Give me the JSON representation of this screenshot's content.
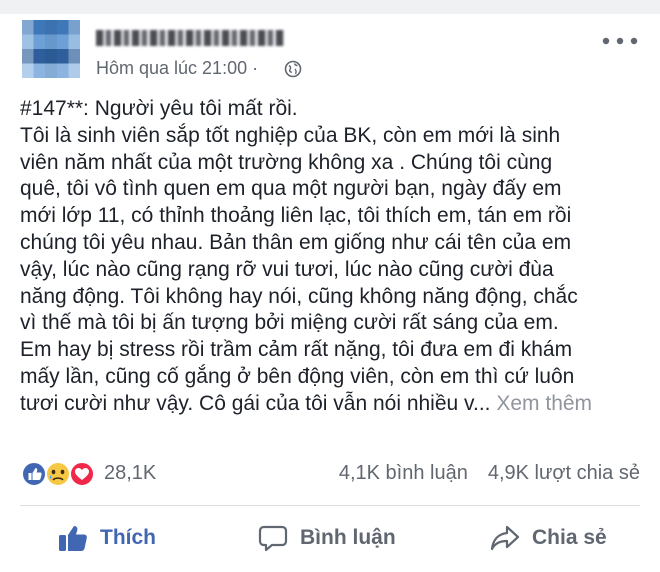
{
  "post": {
    "time": "Hôm qua lúc 21:00 ·",
    "lines": [
      "#147**: Người yêu tôi mất rồi.",
      "Tôi là sinh viên sắp tốt nghiệp của BK, còn em mới là sinh",
      "viên năm nhất của một trường không xa . Chúng tôi cùng",
      "quê, tôi vô tình quen em qua một người bạn, ngày đấy em",
      "mới lớp 11, có thỉnh thoảng liên lạc, tôi thích em, tán em rồi",
      "chúng tôi yêu nhau. Bản thân em giống như cái tên của em",
      "vậy, lúc nào cũng rạng rỡ vui tươi, lúc nào cũng cười đùa",
      "năng động. Tôi không hay nói, cũng không năng động, chắc",
      "vì thế mà tôi bị ấn tượng bởi miệng cười rất sáng của em.",
      "Em hay bị stress rồi trầm cảm rất nặng, tôi đưa em đi khám",
      "mấy lần, cũng cố gắng ở bên động viên, còn em thì cứ luôn"
    ],
    "last_line": "tươi cười như vậy. Cô gái của tôi vẫn nói nhiều v...",
    "see_more": "Xem thêm"
  },
  "stats": {
    "reactions_count": "28,1K",
    "comments": "4,1K bình luận",
    "shares": "4,9K lượt chia sẻ"
  },
  "actions": {
    "like": "Thích",
    "comment": "Bình luận",
    "share": "Chia sẻ"
  },
  "colors": {
    "like_blue": "#4267b2",
    "text": "#1d2129",
    "muted": "#616770",
    "love_red": "#f0284a",
    "sad_yellow": "#f7c844"
  },
  "icons": [
    "globe-icon",
    "more-icon",
    "like-reaction-icon",
    "sad-reaction-icon",
    "love-reaction-icon",
    "thumbs-up-icon",
    "comment-icon",
    "share-icon"
  ]
}
